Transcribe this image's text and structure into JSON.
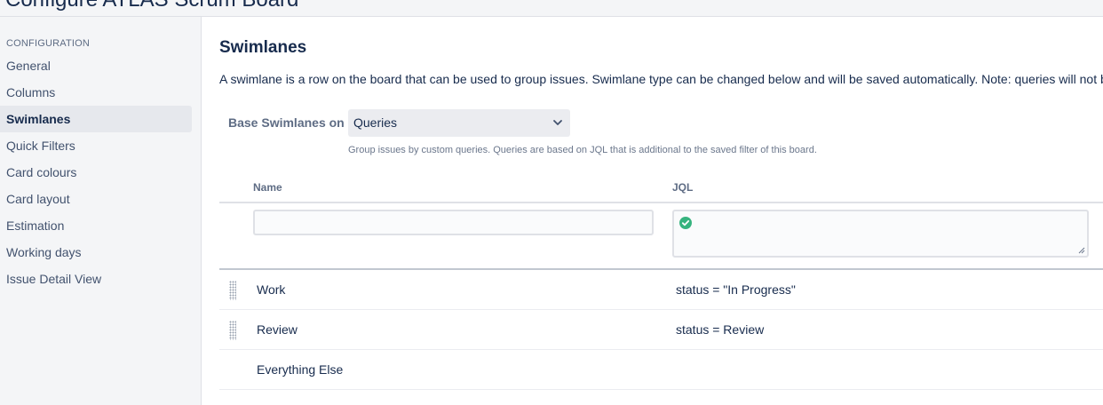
{
  "header": {
    "title": "Configure ATLAS Scrum Board"
  },
  "sidebar": {
    "heading": "CONFIGURATION",
    "items": [
      {
        "label": "General",
        "active": false
      },
      {
        "label": "Columns",
        "active": false
      },
      {
        "label": "Swimlanes",
        "active": true
      },
      {
        "label": "Quick Filters",
        "active": false
      },
      {
        "label": "Card colours",
        "active": false
      },
      {
        "label": "Card layout",
        "active": false
      },
      {
        "label": "Estimation",
        "active": false
      },
      {
        "label": "Working days",
        "active": false
      },
      {
        "label": "Issue Detail View",
        "active": false
      }
    ]
  },
  "main": {
    "title": "Swimlanes",
    "description": "A swimlane is a row on the board that can be used to group issues. Swimlane type can be changed below and will be saved automatically. Note: queries will not be saved",
    "base_label": "Base Swimlanes on",
    "base_value": "Queries",
    "helper": "Group issues by custom queries. Queries are based on JQL that is additional to the saved filter of this board.",
    "table": {
      "col_name": "Name",
      "col_jql": "JQL",
      "new_name_value": "",
      "new_jql_value": "",
      "rows": [
        {
          "name": "Work",
          "jql": "status = \"In Progress\"",
          "draggable": true
        },
        {
          "name": "Review",
          "jql": "status = Review",
          "draggable": true
        },
        {
          "name": "Everything Else",
          "jql": "",
          "draggable": false
        }
      ]
    }
  },
  "colors": {
    "valid_check": "#36b37e",
    "active_bg": "#e6e8ed"
  }
}
